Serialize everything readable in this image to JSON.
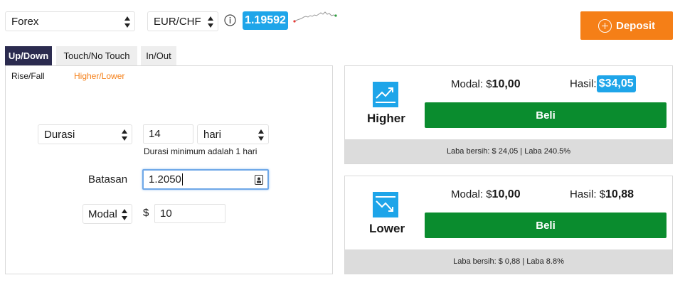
{
  "top": {
    "market_select": "Forex",
    "symbol_select": "EUR/CHF",
    "info_icon": "info-circle-icon",
    "price": "1.19592",
    "deposit_label": "Deposit"
  },
  "tabs": [
    {
      "label": "Up/Down",
      "active": true
    },
    {
      "label": "Touch/No Touch",
      "active": false
    },
    {
      "label": "In/Out",
      "active": false
    }
  ],
  "subtabs": [
    {
      "label": "Rise/Fall",
      "active": false
    },
    {
      "label": "Higher/Lower",
      "active": true
    }
  ],
  "form": {
    "duration_type": "Durasi",
    "duration_value": "14",
    "duration_unit": "hari",
    "duration_hint": "Durasi minimum adalah 1 hari",
    "barrier_label": "Batasan",
    "barrier_value": "1.2050",
    "amount_type": "Modal",
    "currency": "$",
    "amount_value": "10"
  },
  "cards": {
    "higher": {
      "label": "Higher",
      "modal_label": "Modal:",
      "modal_currency": "$",
      "modal_value": "10,00",
      "hasil_label": "Hasil:",
      "hasil_currency": "$",
      "hasil_value": "34,05",
      "buy_label": "Beli",
      "footer": "Laba bersih: $ 24,05 | Laba 240.5%"
    },
    "lower": {
      "label": "Lower",
      "modal_label": "Modal:",
      "modal_currency": "$",
      "modal_value": "10,00",
      "hasil_label": "Hasil:",
      "hasil_currency": "$",
      "hasil_value": "10,88",
      "buy_label": "Beli",
      "footer": "Laba bersih: $ 0,88 | Laba 8.8%"
    }
  },
  "colors": {
    "accent_blue": "#1ea5e9",
    "deposit_orange": "#f57f17",
    "buy_green": "#0a8c2e",
    "active_tab": "#2b2b4f",
    "active_subtab": "#f57f17"
  }
}
